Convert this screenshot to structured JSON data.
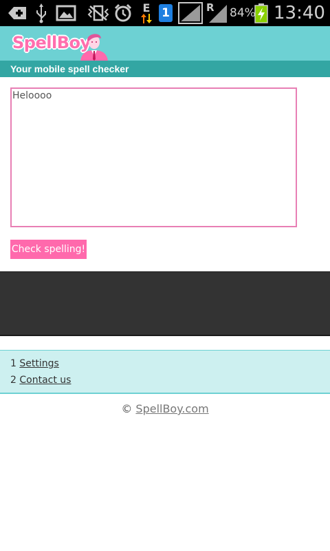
{
  "status_bar": {
    "battery_percent": "84%",
    "time": "13:40",
    "network_letter_e": "E",
    "network_letter_r": "R",
    "sim_badge": "1",
    "icons": [
      "add-icon",
      "usb-icon",
      "image-icon",
      "vibrate-off-icon",
      "alarm-icon",
      "data-arrows-icon",
      "sim-icon",
      "signal-icon",
      "roaming-signal-icon",
      "battery-charging-icon"
    ]
  },
  "header": {
    "logo_text": "SpellBoy",
    "tagline": "Your mobile spell checker"
  },
  "form": {
    "text_value": "Heloooo",
    "check_button_label": "Check spelling!"
  },
  "links": [
    {
      "number": "1",
      "label": "Settings"
    },
    {
      "number": "2",
      "label": "Contact us"
    }
  ],
  "footer": {
    "copyright_symbol": "©",
    "site_link": "SpellBoy.com"
  },
  "colors": {
    "header_bg": "#6dd1d3",
    "tagline_bg": "#33a6a3",
    "accent_pink": "#ff69ac",
    "links_bg": "#cdf0f0"
  }
}
